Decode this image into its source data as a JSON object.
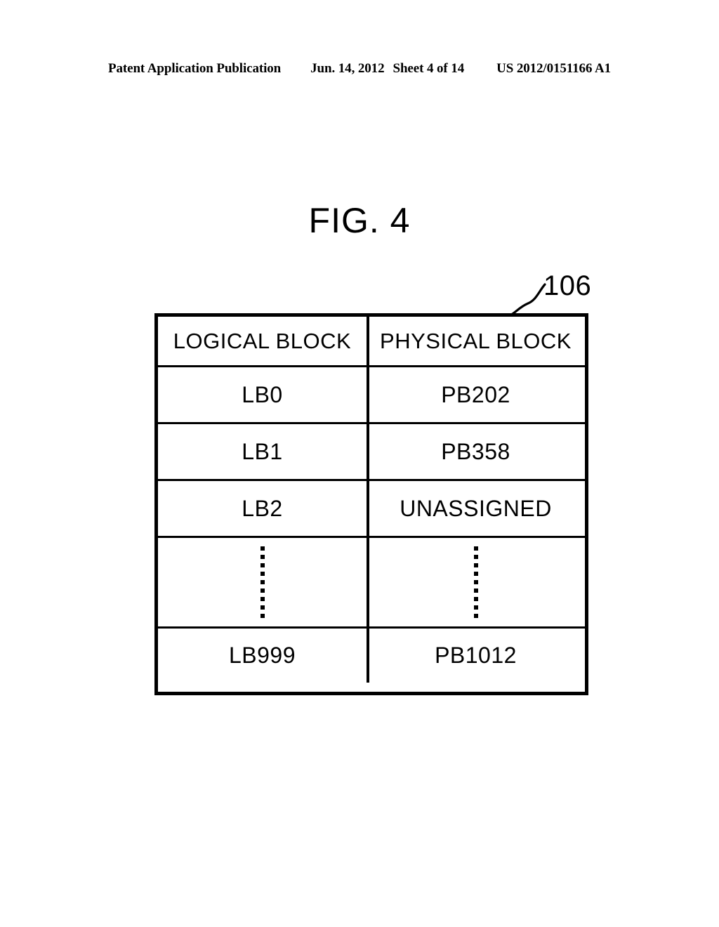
{
  "header": {
    "publication": "Patent Application Publication",
    "date": "Jun. 14, 2012",
    "sheet": "Sheet 4 of 14",
    "patent_number": "US 2012/0151166 A1"
  },
  "figure": {
    "title": "FIG. 4",
    "reference_numeral": "106"
  },
  "table": {
    "columns": [
      "LOGICAL BLOCK",
      "PHYSICAL BLOCK"
    ],
    "rows": [
      {
        "logical_block": "LB0",
        "physical_block": "PB202"
      },
      {
        "logical_block": "LB1",
        "physical_block": "PB358"
      },
      {
        "logical_block": "LB2",
        "physical_block": "UNASSIGNED"
      },
      {
        "logical_block": "⋮",
        "physical_block": "⋮",
        "is_ellipsis": true
      },
      {
        "logical_block": "LB999",
        "physical_block": "PB1012"
      }
    ]
  },
  "colors": {
    "ink": "#000000",
    "page": "#ffffff"
  }
}
